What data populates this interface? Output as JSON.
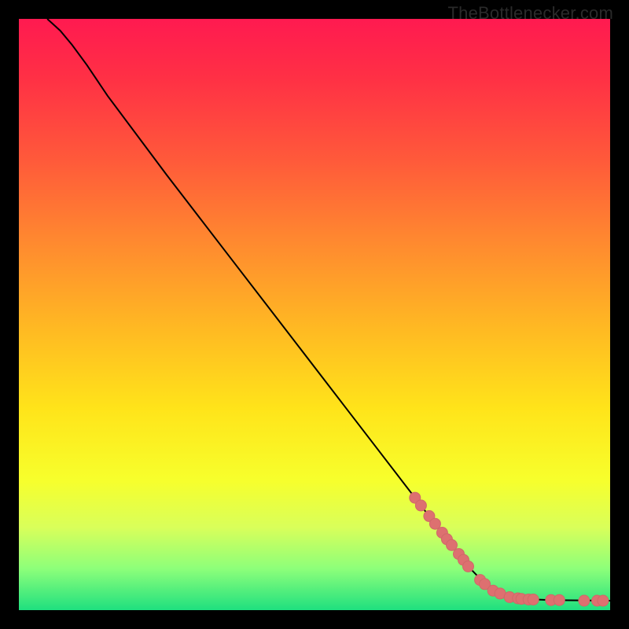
{
  "watermark": "TheBottlenecker.com",
  "colors": {
    "frame": "#000000",
    "curve_stroke": "#000000",
    "marker_fill": "#dd7070",
    "marker_stroke": "#d06868"
  },
  "chart_data": {
    "type": "line",
    "title": "",
    "xlabel": "",
    "ylabel": "",
    "xlim": [
      0,
      100
    ],
    "ylim": [
      0,
      100
    ],
    "curve_points": [
      {
        "x": 4.8,
        "y": 100.0
      },
      {
        "x": 7.0,
        "y": 98.0
      },
      {
        "x": 9.0,
        "y": 95.6
      },
      {
        "x": 11.5,
        "y": 92.2
      },
      {
        "x": 15.0,
        "y": 87.0
      },
      {
        "x": 25.0,
        "y": 73.6
      },
      {
        "x": 35.0,
        "y": 60.6
      },
      {
        "x": 45.0,
        "y": 47.6
      },
      {
        "x": 55.0,
        "y": 34.6
      },
      {
        "x": 65.0,
        "y": 21.6
      },
      {
        "x": 72.0,
        "y": 12.5
      },
      {
        "x": 76.0,
        "y": 7.4
      },
      {
        "x": 79.0,
        "y": 4.3
      },
      {
        "x": 82.0,
        "y": 2.6
      },
      {
        "x": 85.0,
        "y": 1.9
      },
      {
        "x": 90.0,
        "y": 1.7
      },
      {
        "x": 100.0,
        "y": 1.6
      }
    ],
    "series": [
      {
        "name": "markers",
        "points": [
          {
            "x": 67.0,
            "y": 19.0
          },
          {
            "x": 68.0,
            "y": 17.7
          },
          {
            "x": 69.4,
            "y": 15.9
          },
          {
            "x": 70.4,
            "y": 14.6
          },
          {
            "x": 71.6,
            "y": 13.1
          },
          {
            "x": 72.4,
            "y": 12.0
          },
          {
            "x": 73.2,
            "y": 11.0
          },
          {
            "x": 74.4,
            "y": 9.5
          },
          {
            "x": 75.2,
            "y": 8.5
          },
          {
            "x": 76.0,
            "y": 7.4
          },
          {
            "x": 78.0,
            "y": 5.1
          },
          {
            "x": 78.8,
            "y": 4.4
          },
          {
            "x": 80.2,
            "y": 3.3
          },
          {
            "x": 81.4,
            "y": 2.8
          },
          {
            "x": 83.0,
            "y": 2.2
          },
          {
            "x": 84.4,
            "y": 2.0
          },
          {
            "x": 85.0,
            "y": 1.9
          },
          {
            "x": 86.2,
            "y": 1.8
          },
          {
            "x": 87.0,
            "y": 1.8
          },
          {
            "x": 90.0,
            "y": 1.7
          },
          {
            "x": 91.4,
            "y": 1.7
          },
          {
            "x": 95.6,
            "y": 1.6
          },
          {
            "x": 97.8,
            "y": 1.6
          },
          {
            "x": 98.8,
            "y": 1.6
          }
        ]
      }
    ]
  }
}
